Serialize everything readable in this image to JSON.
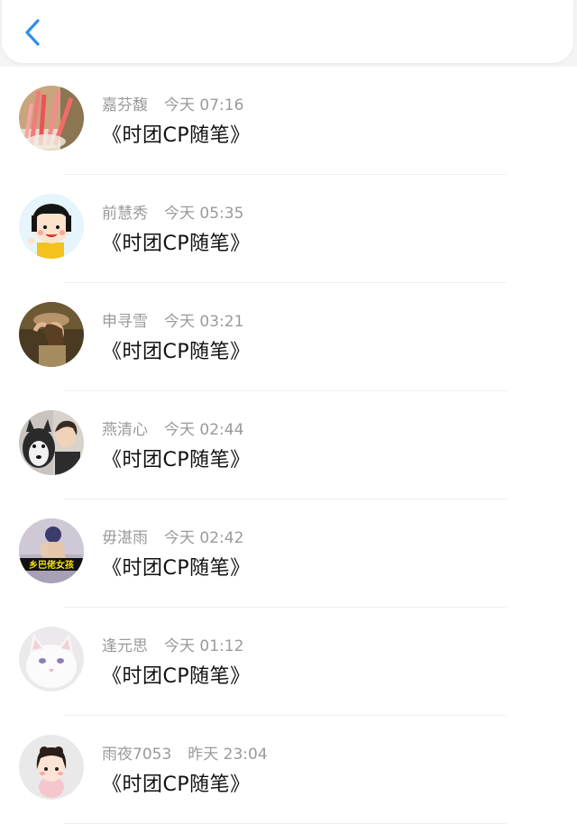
{
  "header": {
    "back_icon": "chevron-left-icon"
  },
  "feed": [
    {
      "name": "嘉芬馥",
      "time": "今天 07:16",
      "title": "《时团CP随笔》",
      "avatar": "pencils-avatar"
    },
    {
      "name": "前慧秀",
      "time": "今天 05:35",
      "title": "《时团CP随笔》",
      "avatar": "cartoon-girl-avatar"
    },
    {
      "name": "申寻雪",
      "time": "今天 03:21",
      "title": "《时团CP随笔》",
      "avatar": "girl-hat-avatar"
    },
    {
      "name": "燕清心",
      "time": "今天 02:44",
      "title": "《时团CP随笔》",
      "avatar": "husky-man-avatar"
    },
    {
      "name": "毋湛雨",
      "time": "今天 02:42",
      "title": "《时团CP随笔》",
      "avatar": "village-girl-avatar",
      "avatar_text": "乡巴佬女孩"
    },
    {
      "name": "逢元思",
      "time": "今天 01:12",
      "title": "《时团CP随笔》",
      "avatar": "white-cat-avatar"
    },
    {
      "name": "雨夜7053",
      "time": "昨天 23:04",
      "title": "《时团CP随笔》",
      "avatar": "doll-girl-avatar"
    }
  ],
  "colors": {
    "accent": "#2f8fe6",
    "meta": "#9a9a9a",
    "title": "#111111"
  }
}
